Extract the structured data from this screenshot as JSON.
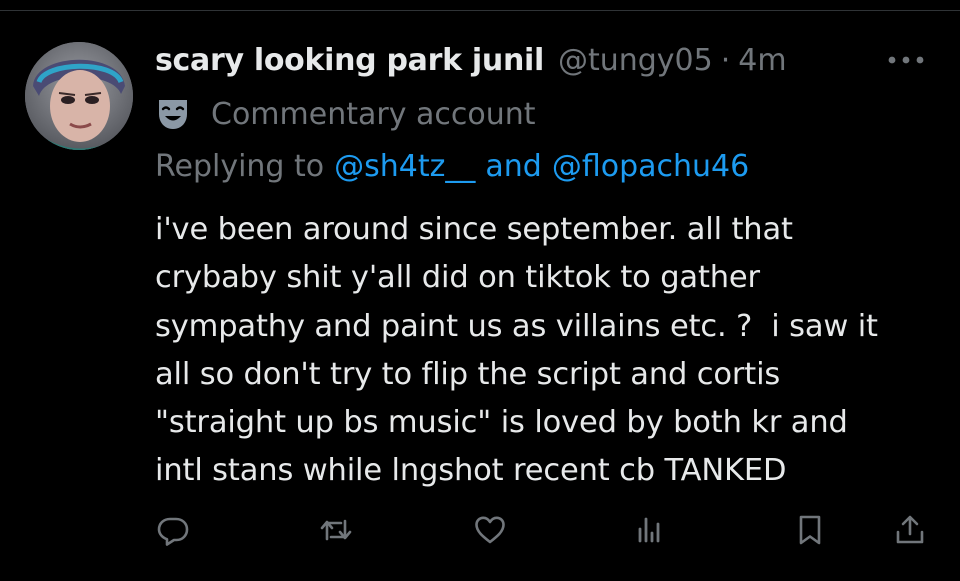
{
  "tweet": {
    "display_name": "scary looking park junil",
    "handle": "@tungy05",
    "separator": "·",
    "time_ago": "4m",
    "label": "Commentary account",
    "reply": {
      "prefix": "Replying to",
      "mention1": "@sh4tz__",
      "connector": "and",
      "mention2": "@flopachu46"
    },
    "text_lines": [
      "i've been around since september. all that",
      "crybaby shit y'all did on tiktok to gather",
      "sympathy and paint us as villains etc. ?  i saw it",
      "all so don't try to flip the script and cortis",
      "\"straight up bs music\" is loved by both kr and",
      "intl stans while lngshot recent cb TANKED"
    ]
  },
  "icons": {
    "more": "more-horizontal-icon",
    "label": "theater-mask-icon",
    "reply": "reply-icon",
    "retweet": "retweet-icon",
    "like": "heart-icon",
    "views": "views-icon",
    "bookmark": "bookmark-icon",
    "share": "share-icon"
  },
  "colors": {
    "background": "#000000",
    "primary_text": "#e7e9ea",
    "secondary_text": "#71767b",
    "link": "#1d9bf0",
    "divider": "#2f3336"
  }
}
